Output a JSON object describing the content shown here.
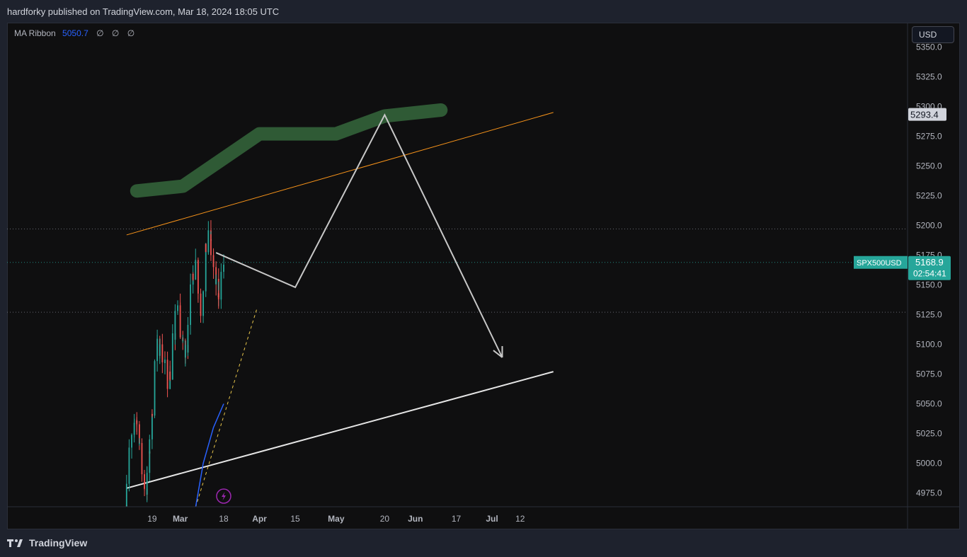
{
  "header": {
    "text": "hardforky published on TradingView.com, Mar 18, 2024 18:05 UTC"
  },
  "legend": {
    "name": "MA Ribbon",
    "value": "5050.7",
    "na": [
      "∅",
      "∅",
      "∅"
    ]
  },
  "currency_button": "USD",
  "footer": {
    "brand": "TradingView"
  },
  "colors": {
    "background": "#0f0f10",
    "up_candle": "#26a69a",
    "down_candle": "#ef5350",
    "ma_line": "#2962ff",
    "trendline_orange": "#f7931a",
    "highlight_green": "#2f5a35",
    "projection_line": "#c8c8c8",
    "price_tag": "#26a69a"
  },
  "chart_data": {
    "type": "candlestick",
    "symbol": "SPX500USD",
    "y_axis": {
      "ticks": [
        "4975.0",
        "5000.0",
        "5025.0",
        "5050.0",
        "5075.0",
        "5100.0",
        "5125.0",
        "5150.0",
        "5175.0",
        "5200.0",
        "5225.0",
        "5250.0",
        "5275.0",
        "5300.0",
        "5325.0",
        "5350.0"
      ],
      "ylim": [
        4963,
        5374
      ]
    },
    "x_axis": {
      "ticks": [
        "19",
        "Mar",
        "18",
        "Apr",
        "15",
        "May",
        "20",
        "Jun",
        "17",
        "Jul",
        "12"
      ]
    },
    "last_price": {
      "value": "5168.9",
      "label": "SPX500USD",
      "countdown": "02:54:41"
    },
    "marked_level": {
      "value": "5293.4"
    },
    "ma_ribbon_value": 5050.7,
    "candles_approx": {
      "start": "Feb 9, 2024",
      "end": "Mar 18, 2024",
      "low": 4960,
      "high": 5195,
      "path_closes": [
        4965,
        4985,
        5000,
        5015,
        5020,
        5035,
        5040,
        5030,
        5015,
        4995,
        4985,
        4978,
        4990,
        5010,
        5030,
        5055,
        5080,
        5095,
        5102,
        5095,
        5088,
        5082,
        5078,
        5070,
        5075,
        5090,
        5105,
        5118,
        5128,
        5130,
        5110,
        5095,
        5088,
        5100,
        5118,
        5140,
        5155,
        5165,
        5170,
        5150,
        5135,
        5130,
        5150,
        5175,
        5185,
        5190,
        5180,
        5170,
        5155,
        5145,
        5138,
        5150,
        5168
      ]
    },
    "drawings": {
      "orange_trendline": {
        "from": {
          "date": "Feb 9, 2024",
          "price": 5192
        },
        "to": {
          "date": "Jul 25, 2024",
          "price": 5295
        }
      },
      "white_trendline": {
        "from": {
          "date": "Feb 9, 2024",
          "price": 4979
        },
        "to": {
          "date": "Jul 25, 2024",
          "price": 5077
        }
      },
      "yellow_dashed": {
        "from": {
          "date": "Mar 7, 2024",
          "price": 4963
        },
        "to": {
          "date": "Mar 31, 2024",
          "price": 5130
        }
      },
      "projection": [
        {
          "date": "Mar 15, 2024",
          "price": 5177
        },
        {
          "date": "Apr 15, 2024",
          "price": 5148
        },
        {
          "date": "May 20, 2024",
          "price": 5293
        },
        {
          "date": "Jul 5, 2024",
          "price": 5089
        }
      ],
      "green_highlight": [
        {
          "date": "Feb 13, 2024",
          "price": 5229
        },
        {
          "date": "Mar 2, 2024",
          "price": 5233
        },
        {
          "date": "Mar 17, 2024",
          "price": 5255
        },
        {
          "date": "Apr 1, 2024",
          "price": 5277
        },
        {
          "date": "May 1, 2024",
          "price": 5277
        },
        {
          "date": "May 20, 2024",
          "price": 5292
        },
        {
          "date": "Jun 11, 2024",
          "price": 5297
        }
      ]
    },
    "ma_line": [
      {
        "date": "Mar 7, 2024",
        "price": 4963
      },
      {
        "date": "Mar 10, 2024",
        "price": 5000
      },
      {
        "date": "Mar 14, 2024",
        "price": 5030
      },
      {
        "date": "Mar 18, 2024",
        "price": 5050
      }
    ],
    "horizontal_levels": [
      5197,
      5168.9,
      5127
    ]
  }
}
